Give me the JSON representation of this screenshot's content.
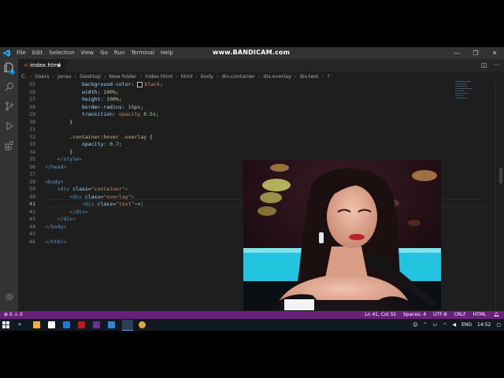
{
  "window": {
    "watermark": "www.BANDICAM.com",
    "menu": [
      "File",
      "Edit",
      "Selection",
      "View",
      "Go",
      "Run",
      "Terminal",
      "Help"
    ],
    "controls": [
      "—",
      "❐",
      "✕"
    ]
  },
  "activity_bar": {
    "icons": [
      "files-icon",
      "search-icon",
      "source-control-icon",
      "run-debug-icon",
      "extensions-icon",
      "settings-gear-icon"
    ],
    "badge": "1"
  },
  "tabs": [
    {
      "label": "index.html",
      "icon": "html-file-icon",
      "dirty": true
    }
  ],
  "tab_actions": [
    "split-editor-icon",
    "more-actions-icon"
  ],
  "breadcrumb": [
    "C:",
    "Users",
    "jenas",
    "Desktop",
    "New folder",
    "index.html",
    "html",
    "body",
    "div.container",
    "div.overlay",
    "div.text",
    "?"
  ],
  "editor": {
    "lines": [
      {
        "n": "25",
        "tokens": [
          [
            "tk-prop",
            "            background-color"
          ],
          [
            "tk-text",
            ": "
          ],
          [
            "swatch",
            ""
          ],
          [
            "tk-val",
            "black"
          ],
          [
            "tk-text",
            ";"
          ]
        ]
      },
      {
        "n": "26",
        "tokens": [
          [
            "tk-prop",
            "            width"
          ],
          [
            "tk-text",
            ": "
          ],
          [
            "tk-num",
            "100%"
          ],
          [
            "tk-text",
            ";"
          ]
        ]
      },
      {
        "n": "27",
        "tokens": [
          [
            "tk-prop",
            "            height"
          ],
          [
            "tk-text",
            ": "
          ],
          [
            "tk-num",
            "100%"
          ],
          [
            "tk-text",
            ";"
          ]
        ]
      },
      {
        "n": "28",
        "tokens": [
          [
            "tk-prop",
            "            border-radius"
          ],
          [
            "tk-text",
            ": "
          ],
          [
            "tk-num",
            "15px"
          ],
          [
            "tk-text",
            ";"
          ]
        ]
      },
      {
        "n": "29",
        "tokens": [
          [
            "tk-prop",
            "            transition"
          ],
          [
            "tk-text",
            ": "
          ],
          [
            "tk-val",
            "opacity "
          ],
          [
            "tk-num",
            "0.5s"
          ],
          [
            "tk-text",
            ";"
          ]
        ]
      },
      {
        "n": "30",
        "tokens": [
          [
            "tk-text",
            "        }"
          ]
        ]
      },
      {
        "n": "31",
        "tokens": []
      },
      {
        "n": "32",
        "tokens": [
          [
            "tk-sel",
            "        .container:hover .overlay"
          ],
          [
            "tk-text",
            " {"
          ]
        ]
      },
      {
        "n": "33",
        "tokens": [
          [
            "tk-prop",
            "            opacity"
          ],
          [
            "tk-text",
            ": "
          ],
          [
            "tk-num",
            "0.7"
          ],
          [
            "tk-text",
            ";"
          ]
        ]
      },
      {
        "n": "34",
        "tokens": [
          [
            "tk-text",
            "        }"
          ]
        ]
      },
      {
        "n": "35",
        "tokens": [
          [
            "tk-punct",
            "    </"
          ],
          [
            "tk-tag",
            "style"
          ],
          [
            "tk-punct",
            ">"
          ]
        ]
      },
      {
        "n": "36",
        "tokens": [
          [
            "tk-punct",
            "</"
          ],
          [
            "tk-tag",
            "head"
          ],
          [
            "tk-punct",
            ">"
          ]
        ]
      },
      {
        "n": "37",
        "tokens": []
      },
      {
        "n": "38",
        "tokens": [
          [
            "tk-punct",
            "<"
          ],
          [
            "tk-tag",
            "body"
          ],
          [
            "tk-punct",
            ">"
          ]
        ]
      },
      {
        "n": "39",
        "tokens": [
          [
            "tk-punct",
            "    <"
          ],
          [
            "tk-tag",
            "div"
          ],
          [
            "tk-attr",
            " class"
          ],
          [
            "tk-text",
            "="
          ],
          [
            "tk-str",
            "\"container\""
          ],
          [
            "tk-punct",
            ">"
          ]
        ]
      },
      {
        "n": "40",
        "tokens": [
          [
            "tk-punct",
            "        <"
          ],
          [
            "tk-tag",
            "div"
          ],
          [
            "tk-attr",
            " class"
          ],
          [
            "tk-text",
            "="
          ],
          [
            "tk-str",
            "\"overlay\""
          ],
          [
            "tk-punct",
            ">"
          ]
        ]
      },
      {
        "n": "41",
        "tokens": [
          [
            "tk-punct",
            "            <"
          ],
          [
            "tk-tag",
            "div"
          ],
          [
            "tk-attr",
            " class"
          ],
          [
            "tk-text",
            "="
          ],
          [
            "tk-str",
            "\"text\""
          ],
          [
            "tk-punct",
            ">"
          ],
          [
            "tk-text",
            "<"
          ],
          [
            "tk-punct",
            "|"
          ]
        ]
      },
      {
        "n": "42",
        "tokens": [
          [
            "tk-punct",
            "        </"
          ],
          [
            "tk-tag",
            "div"
          ],
          [
            "tk-punct",
            ">"
          ]
        ]
      },
      {
        "n": "43",
        "tokens": [
          [
            "tk-punct",
            "    </"
          ],
          [
            "tk-tag",
            "div"
          ],
          [
            "tk-punct",
            ">"
          ]
        ]
      },
      {
        "n": "44",
        "tokens": [
          [
            "tk-punct",
            "</"
          ],
          [
            "tk-tag",
            "body"
          ],
          [
            "tk-punct",
            ">"
          ]
        ]
      },
      {
        "n": "45",
        "tokens": []
      },
      {
        "n": "46",
        "tokens": [
          [
            "tk-punct",
            "</"
          ],
          [
            "tk-tag",
            "html"
          ],
          [
            "tk-punct",
            ">"
          ]
        ]
      }
    ],
    "active_line": "41"
  },
  "status_bar": {
    "left": "⊗ 0  ⚠ 0",
    "items": [
      "Ln 41, Col 32",
      "Spaces: 4",
      "UTF-8",
      "CRLF",
      "HTML"
    ],
    "color": "#68217a"
  },
  "taskbar": {
    "language": "ENG",
    "time": "14:52"
  }
}
